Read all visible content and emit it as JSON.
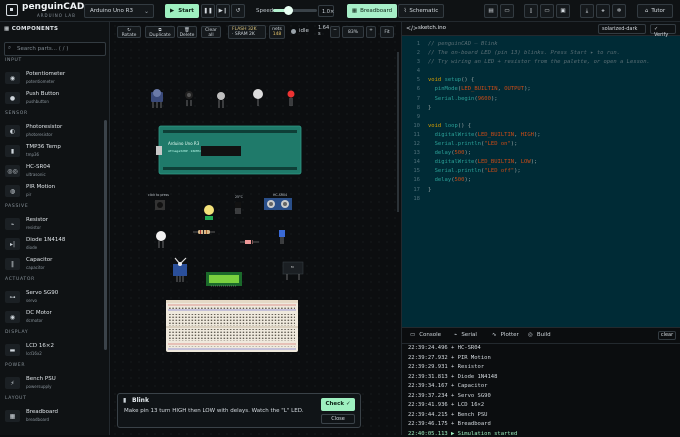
{
  "header": {
    "brand": "penguinCAD",
    "brand_sub": "ARDUINO LAB",
    "board_select": "Arduino Uno R3",
    "start_label": "Start",
    "speed_label": "Speed",
    "speed_value": "1.0×",
    "speed_fraction": 0.35,
    "flash_line": "FLASH 32K",
    "sram_line": "· SRAM 2K",
    "nets_label": "nets",
    "nets_value": "148",
    "status_text": "idle",
    "time_value": "1.64 s",
    "zoom_value": "83%",
    "fit_label": "Fit",
    "tab_breadboard": "Breadboard",
    "tab_schematic": "Schematic",
    "tutor_label": "Tutor",
    "accent": "#9ef0c0"
  },
  "sidebar": {
    "title": "COMPONENTS",
    "search_placeholder": "Search parts...  ( / )",
    "categories": [
      {
        "name": "INPUT",
        "items": [
          {
            "name": "Potentiometer",
            "sub": "potentiometer",
            "icon": "knob-icon"
          },
          {
            "name": "Push Button",
            "sub": "pushbutton",
            "icon": "button-icon"
          }
        ]
      },
      {
        "name": "SENSOR",
        "items": [
          {
            "name": "Photoresistor",
            "sub": "photoresistor",
            "icon": "ldr-icon"
          },
          {
            "name": "TMP36 Temp",
            "sub": "tmp36",
            "icon": "thermo-icon"
          },
          {
            "name": "HC-SR04",
            "sub": "ultrasonic",
            "icon": "ultrasonic-icon"
          },
          {
            "name": "PIR Motion",
            "sub": "pir",
            "icon": "pir-icon"
          }
        ]
      },
      {
        "name": "PASSIVE",
        "items": [
          {
            "name": "Resistor",
            "sub": "resistor",
            "icon": "resistor-icon"
          },
          {
            "name": "Diode 1N4148",
            "sub": "diode",
            "icon": "diode-icon"
          },
          {
            "name": "Capacitor",
            "sub": "capacitor",
            "icon": "capacitor-icon"
          }
        ]
      },
      {
        "name": "ACTUATOR",
        "items": [
          {
            "name": "Servo SG90",
            "sub": "servo",
            "icon": "servo-icon"
          },
          {
            "name": "DC Motor",
            "sub": "dcmotor",
            "icon": "motor-icon"
          }
        ]
      },
      {
        "name": "DISPLAY",
        "items": [
          {
            "name": "LCD 16×2",
            "sub": "lcd16x2",
            "icon": "lcd-icon"
          }
        ]
      },
      {
        "name": "POWER",
        "items": [
          {
            "name": "Bench PSU",
            "sub": "powersupply",
            "icon": "psu-icon"
          }
        ]
      },
      {
        "name": "LAYOUT",
        "items": [
          {
            "name": "Breadboard",
            "sub": "breadboard",
            "icon": "breadboard-icon"
          }
        ]
      }
    ]
  },
  "canvas": {
    "tools": [
      "Rotate",
      "Duplicate",
      "Delete",
      "Clear all"
    ],
    "board_title": "Arduino Uno R3",
    "board_sub": "ATmega328P · 16MHz",
    "button_caption": "click to press",
    "pir_caption": "PIR",
    "sonar_caption": "HC-SR04",
    "temp_caption": "25°C",
    "ldr_caption": "LDR",
    "motor_caption": "M"
  },
  "editor": {
    "filename": "sketch.ino",
    "theme": "solarized-dark",
    "verify_label": "Verify",
    "lines": [
      [
        {
          "t": "// penguinCAD — Blink",
          "c": "c-cm"
        }
      ],
      [
        {
          "t": "// The on-board LED (pin 13) blinks. Press Start ▸ to run.",
          "c": "c-cm"
        }
      ],
      [
        {
          "t": "// Try wiring an LED + resistor from the palette, or open a Lesson.",
          "c": "c-cm"
        }
      ],
      [],
      [
        {
          "t": "void ",
          "c": "c-kw"
        },
        {
          "t": "setup",
          "c": "c-fn"
        },
        {
          "t": "() {",
          "c": "c-tx"
        }
      ],
      [
        {
          "t": "  ",
          "c": "c-tx"
        },
        {
          "t": "pinMode",
          "c": "c-fn"
        },
        {
          "t": "(",
          "c": "c-tx"
        },
        {
          "t": "LED_BUILTIN",
          "c": "c-st"
        },
        {
          "t": ", ",
          "c": "c-tx"
        },
        {
          "t": "OUTPUT",
          "c": "c-st"
        },
        {
          "t": ");",
          "c": "c-tx"
        }
      ],
      [
        {
          "t": "  ",
          "c": "c-tx"
        },
        {
          "t": "Serial.begin",
          "c": "c-fn"
        },
        {
          "t": "(",
          "c": "c-tx"
        },
        {
          "t": "9600",
          "c": "c-st"
        },
        {
          "t": ");",
          "c": "c-tx"
        }
      ],
      [
        {
          "t": "}",
          "c": "c-tx"
        }
      ],
      [],
      [
        {
          "t": "void ",
          "c": "c-kw"
        },
        {
          "t": "loop",
          "c": "c-fn"
        },
        {
          "t": "() {",
          "c": "c-tx"
        }
      ],
      [
        {
          "t": "  ",
          "c": "c-tx"
        },
        {
          "t": "digitalWrite",
          "c": "c-fn"
        },
        {
          "t": "(",
          "c": "c-tx"
        },
        {
          "t": "LED_BUILTIN",
          "c": "c-st"
        },
        {
          "t": ", ",
          "c": "c-tx"
        },
        {
          "t": "HIGH",
          "c": "c-st"
        },
        {
          "t": ");",
          "c": "c-tx"
        }
      ],
      [
        {
          "t": "  ",
          "c": "c-tx"
        },
        {
          "t": "Serial.println",
          "c": "c-fn"
        },
        {
          "t": "(",
          "c": "c-tx"
        },
        {
          "t": "\"LED on\"",
          "c": "c-st"
        },
        {
          "t": ");",
          "c": "c-tx"
        }
      ],
      [
        {
          "t": "  ",
          "c": "c-tx"
        },
        {
          "t": "delay",
          "c": "c-fn"
        },
        {
          "t": "(",
          "c": "c-tx"
        },
        {
          "t": "500",
          "c": "c-st"
        },
        {
          "t": ");",
          "c": "c-tx"
        }
      ],
      [
        {
          "t": "  ",
          "c": "c-tx"
        },
        {
          "t": "digitalWrite",
          "c": "c-fn"
        },
        {
          "t": "(",
          "c": "c-tx"
        },
        {
          "t": "LED_BUILTIN",
          "c": "c-st"
        },
        {
          "t": ", ",
          "c": "c-tx"
        },
        {
          "t": "LOW",
          "c": "c-st"
        },
        {
          "t": ");",
          "c": "c-tx"
        }
      ],
      [
        {
          "t": "  ",
          "c": "c-tx"
        },
        {
          "t": "Serial.println",
          "c": "c-fn"
        },
        {
          "t": "(",
          "c": "c-tx"
        },
        {
          "t": "\"LED off\"",
          "c": "c-st"
        },
        {
          "t": ");",
          "c": "c-tx"
        }
      ],
      [
        {
          "t": "  ",
          "c": "c-tx"
        },
        {
          "t": "delay",
          "c": "c-fn"
        },
        {
          "t": "(",
          "c": "c-tx"
        },
        {
          "t": "500",
          "c": "c-st"
        },
        {
          "t": ");",
          "c": "c-tx"
        }
      ],
      [
        {
          "t": "}",
          "c": "c-tx"
        }
      ],
      []
    ]
  },
  "console": {
    "tabs": [
      "Console",
      "Serial",
      "Plotter",
      "Build"
    ],
    "clear_label": "clear",
    "logs": [
      "22:39:24.496 + HC-SR04",
      "22:39:27.932 + PIR Motion",
      "22:39:29.931 + Resistor",
      "22:39:31.813 + Diode 1N4148",
      "22:39:34.167 + Capacitor",
      "22:39:37.234 + Servo SG90",
      "22:39:41.936 + LCD 16×2",
      "22:39:44.215 + Bench PSU",
      "22:39:46.175 + Breadboard"
    ],
    "last_log": "22:40:05.113 ▶ Simulation started"
  },
  "tutor": {
    "title": "Blink",
    "text": "Make pin 13 turn HIGH then LOW with delays. Watch the \"L\" LED.",
    "check_label": "Check ✓",
    "close_label": "Close"
  }
}
